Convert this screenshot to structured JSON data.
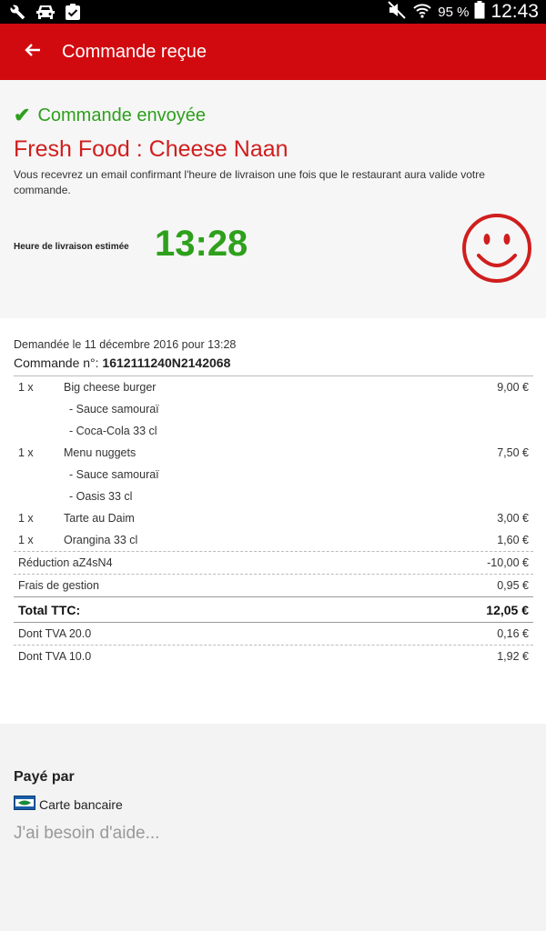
{
  "status_bar": {
    "battery": "95 %",
    "time": "12:43"
  },
  "app_bar": {
    "title": "Commande reçue"
  },
  "confirmation": {
    "status": "Commande envoyée",
    "restaurant": "Fresh Food : Cheese Naan",
    "email_note": "Vous recevrez un email confirmant l'heure de livraison une fois que le restaurant aura valide votre commande.",
    "eta_label": "Heure de livraison estimée",
    "eta_time": "13:28"
  },
  "order": {
    "requested": "Demandée le 11 décembre 2016 pour 13:28",
    "number_label": "Commande n°:",
    "number": "1612111240N2142068",
    "lines": [
      {
        "qty": "1 x",
        "name": "Big cheese burger",
        "price": "9,00 €"
      },
      {
        "qty": "",
        "name": "- Sauce samouraï",
        "price": ""
      },
      {
        "qty": "",
        "name": "- Coca-Cola 33 cl",
        "price": ""
      },
      {
        "qty": "1 x",
        "name": "Menu nuggets",
        "price": "7,50 €"
      },
      {
        "qty": "",
        "name": "- Sauce samouraï",
        "price": ""
      },
      {
        "qty": "",
        "name": "- Oasis 33 cl",
        "price": ""
      },
      {
        "qty": "1 x",
        "name": "Tarte au Daim",
        "price": "3,00 €"
      },
      {
        "qty": "1 x",
        "name": "Orangina 33 cl",
        "price": "1,60 €"
      }
    ],
    "discount": {
      "label": "Réduction aZ4sN4",
      "value": "-10,00 €"
    },
    "fees": {
      "label": "Frais de gestion",
      "value": "0,95 €"
    },
    "total": {
      "label": "Total TTC:",
      "value": "12,05 €"
    },
    "vat": [
      {
        "label": "Dont TVA 20.0",
        "value": "0,16 €"
      },
      {
        "label": "Dont TVA 10.0",
        "value": "1,92 €"
      }
    ]
  },
  "payment": {
    "title": "Payé par",
    "method": "Carte bancaire",
    "help": "J'ai besoin d'aide..."
  },
  "colors": {
    "brand_red": "#d10a10",
    "success_green": "#2ea01c",
    "restaurant_red": "#d01e1e"
  }
}
